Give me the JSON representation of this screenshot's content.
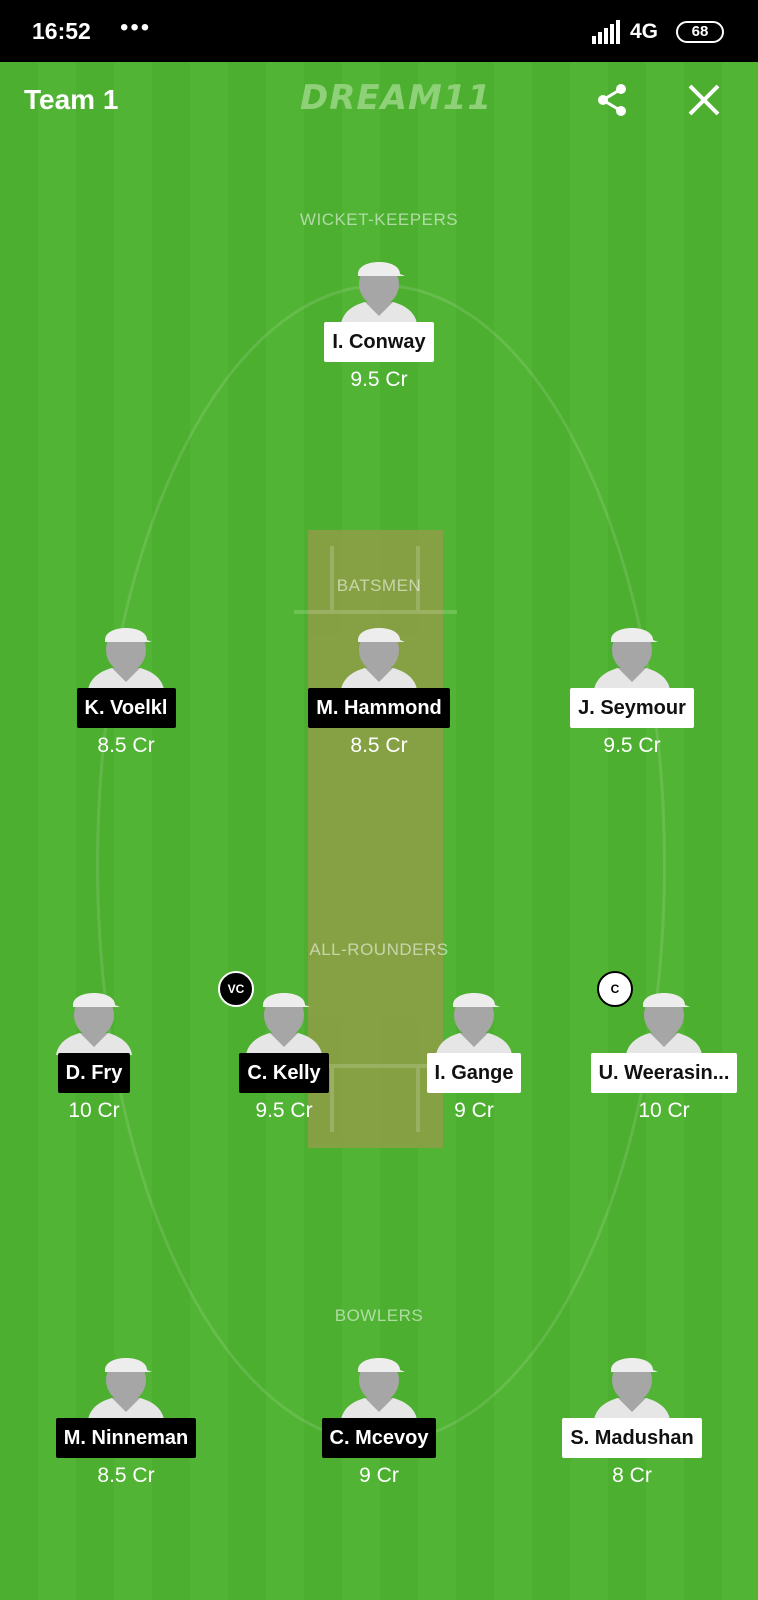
{
  "status": {
    "time": "16:52",
    "dots": "•••",
    "network": "4G",
    "battery": "68"
  },
  "header": {
    "title": "Team 1",
    "logo": "DREAM11"
  },
  "sections": {
    "wk": "WICKET-KEEPERS",
    "bat": "BATSMEN",
    "ar": "ALL-ROUNDERS",
    "bowl": "BOWLERS"
  },
  "players": [
    {
      "name": "I. Conway",
      "price": "9.5 Cr"
    },
    {
      "name": "K. Voelkl",
      "price": "8.5 Cr"
    },
    {
      "name": "M. Hammond",
      "price": "8.5 Cr"
    },
    {
      "name": "J. Seymour",
      "price": "9.5 Cr"
    },
    {
      "name": "D. Fry",
      "price": "10 Cr"
    },
    {
      "name": "C. Kelly",
      "price": "9.5 Cr",
      "role_badge": "VC"
    },
    {
      "name": "I. Gange",
      "price": "9 Cr"
    },
    {
      "name": "U. Weerasin...",
      "price": "10 Cr",
      "role_badge": "C"
    },
    {
      "name": "M. Ninneman",
      "price": "8.5 Cr"
    },
    {
      "name": "C. Mcevoy",
      "price": "9 Cr"
    },
    {
      "name": "S. Madushan",
      "price": "8 Cr"
    }
  ],
  "icons": {
    "share": "share-icon",
    "close": "close-icon",
    "avatar": "player-avatar-icon"
  }
}
